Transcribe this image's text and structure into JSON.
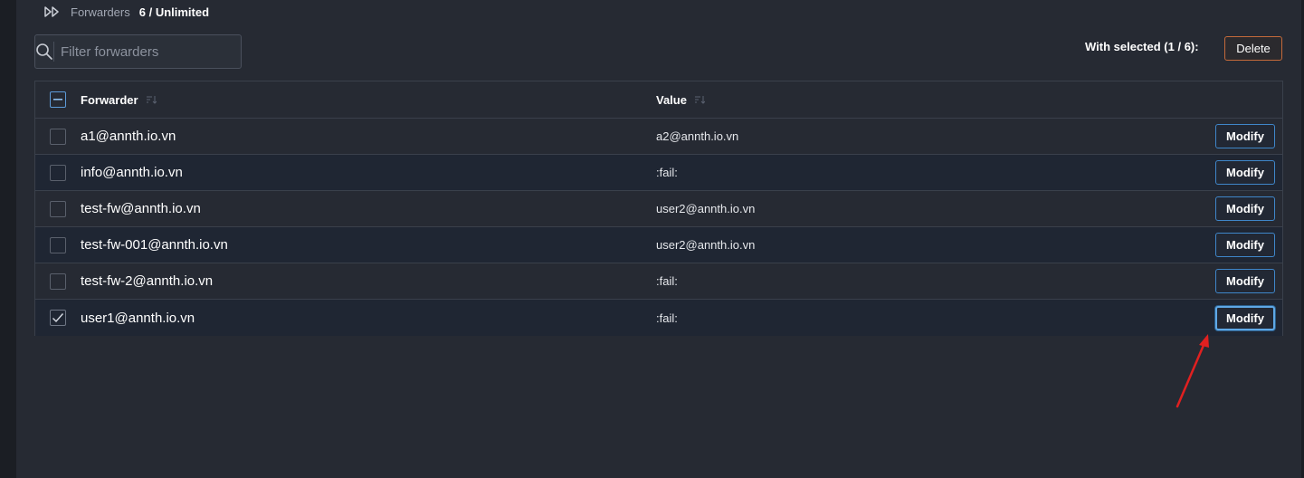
{
  "breadcrumb": {
    "label": "Forwarders",
    "count": "6 / Unlimited"
  },
  "search": {
    "placeholder": "Filter forwarders",
    "value": ""
  },
  "bulk": {
    "with_selected": "With selected (1 / 6):",
    "delete_label": "Delete"
  },
  "table": {
    "headers": {
      "forwarder": "Forwarder",
      "value": "Value"
    },
    "rows": [
      {
        "forwarder": "a1@annth.io.vn",
        "value": "a2@annth.io.vn",
        "checked": false,
        "action": "Modify"
      },
      {
        "forwarder": "info@annth.io.vn",
        "value": ":fail:",
        "checked": false,
        "action": "Modify"
      },
      {
        "forwarder": "test-fw@annth.io.vn",
        "value": "user2@annth.io.vn",
        "checked": false,
        "action": "Modify"
      },
      {
        "forwarder": "test-fw-001@annth.io.vn",
        "value": "user2@annth.io.vn",
        "checked": false,
        "action": "Modify"
      },
      {
        "forwarder": "test-fw-2@annth.io.vn",
        "value": ":fail:",
        "checked": false,
        "action": "Modify"
      },
      {
        "forwarder": "user1@annth.io.vn",
        "value": ":fail:",
        "checked": true,
        "action": "Modify"
      }
    ]
  },
  "colors": {
    "accent": "#3f86c9",
    "delete_border": "#c46a3a",
    "annotation_arrow": "#e02020",
    "background": "#262a33"
  },
  "icons": {
    "breadcrumb": "forward-double-icon",
    "search": "search-icon",
    "sort": "sort-icon",
    "check": "check-icon"
  }
}
